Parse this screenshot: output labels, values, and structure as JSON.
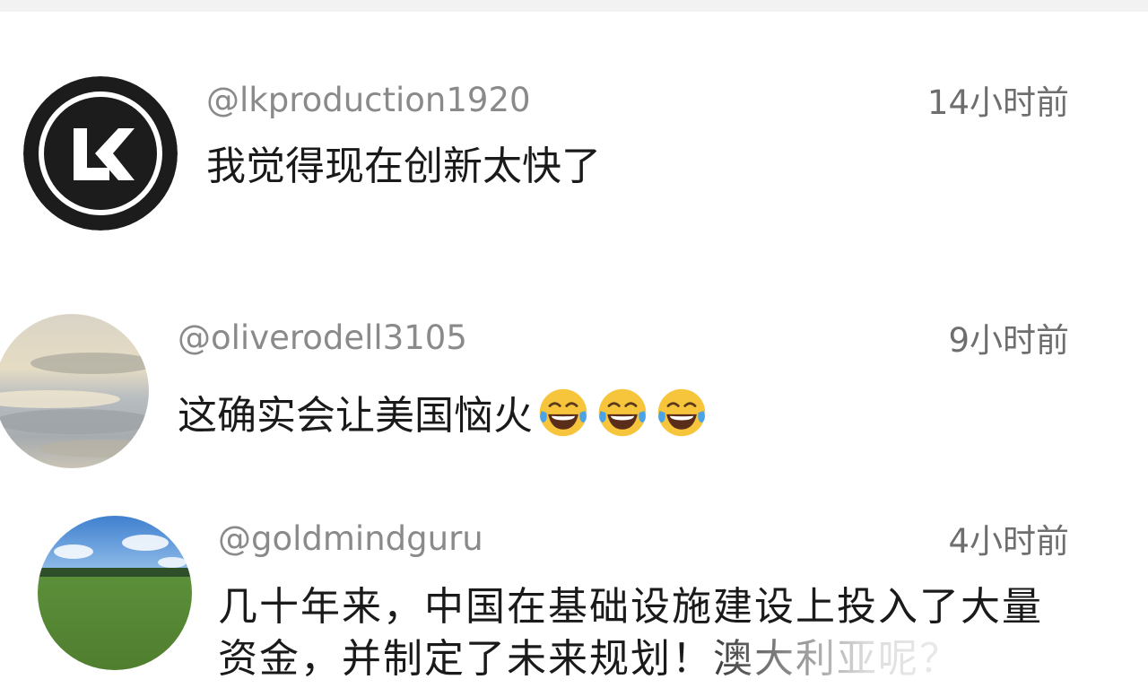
{
  "comments": [
    {
      "username": "@lkproduction1920",
      "time": "14小时前",
      "text": "我觉得现在创新太快了",
      "avatar_icon": "lk-logo-icon",
      "avatar_text": "LK"
    },
    {
      "username": "@oliverodell3105",
      "time": "9小时前",
      "text": "这确实会让美国恼火",
      "emoji": "face-with-tears-of-joy",
      "emoji_count": 3,
      "avatar_icon": "sky-photo-avatar"
    },
    {
      "username": "@goldmindguru",
      "time": "4小时前",
      "text": "几十年来，中国在基础设施建设上投入了大量资金，并制定了未来规划！澳大利亚呢？",
      "avatar_icon": "field-photo-avatar"
    }
  ],
  "colors": {
    "username": "#8a8a8a",
    "timestamp": "#6e6e6e",
    "text": "#1a1a1a",
    "background": "#ffffff",
    "lk_logo_bg": "#1c1c1c"
  }
}
